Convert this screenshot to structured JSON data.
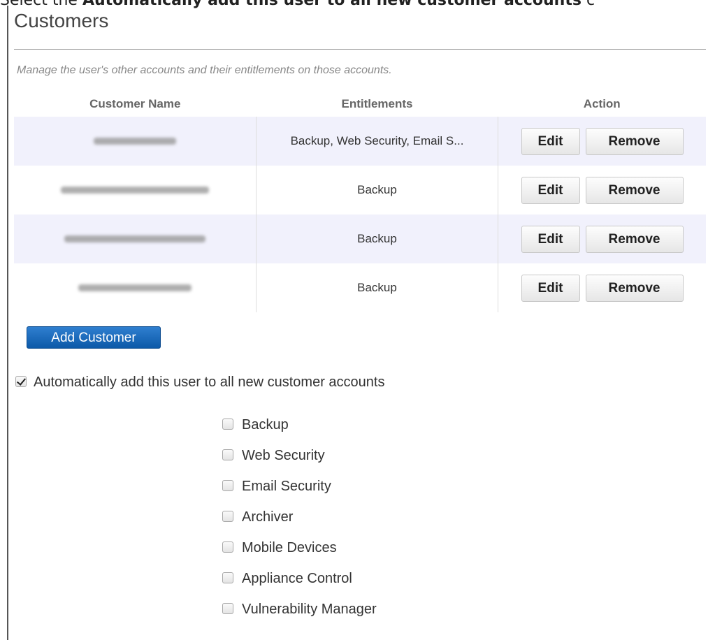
{
  "caption": {
    "prefix": "Select the ",
    "bold": "Automatically add this user to all new customer accounts",
    "suffix": " c"
  },
  "section": {
    "title": "Customers",
    "subtitle": "Manage the user's other accounts and their entitlements on those accounts."
  },
  "table": {
    "headers": {
      "customer_name": "Customer Name",
      "entitlements": "Entitlements",
      "action": "Action"
    },
    "rows": [
      {
        "customer_name": "",
        "entitlements": "Backup, Web Security, Email S...",
        "edit": "Edit",
        "remove": "Remove"
      },
      {
        "customer_name": "",
        "entitlements": "Backup",
        "edit": "Edit",
        "remove": "Remove"
      },
      {
        "customer_name": "",
        "entitlements": "Backup",
        "edit": "Edit",
        "remove": "Remove"
      },
      {
        "customer_name": "",
        "entitlements": "Backup",
        "edit": "Edit",
        "remove": "Remove"
      }
    ]
  },
  "add_customer_label": "Add Customer",
  "auto_add": {
    "label": "Automatically add this user to all new customer accounts",
    "checked": true
  },
  "entitlement_options": [
    {
      "label": "Backup",
      "checked": false
    },
    {
      "label": "Web Security",
      "checked": false
    },
    {
      "label": "Email Security",
      "checked": false
    },
    {
      "label": "Archiver",
      "checked": false
    },
    {
      "label": "Mobile Devices",
      "checked": false
    },
    {
      "label": "Appliance Control",
      "checked": false
    },
    {
      "label": "Vulnerability Manager",
      "checked": false
    }
  ],
  "colors": {
    "primary_button": "#0c59a8",
    "row_alt": "#f1f1fc"
  }
}
